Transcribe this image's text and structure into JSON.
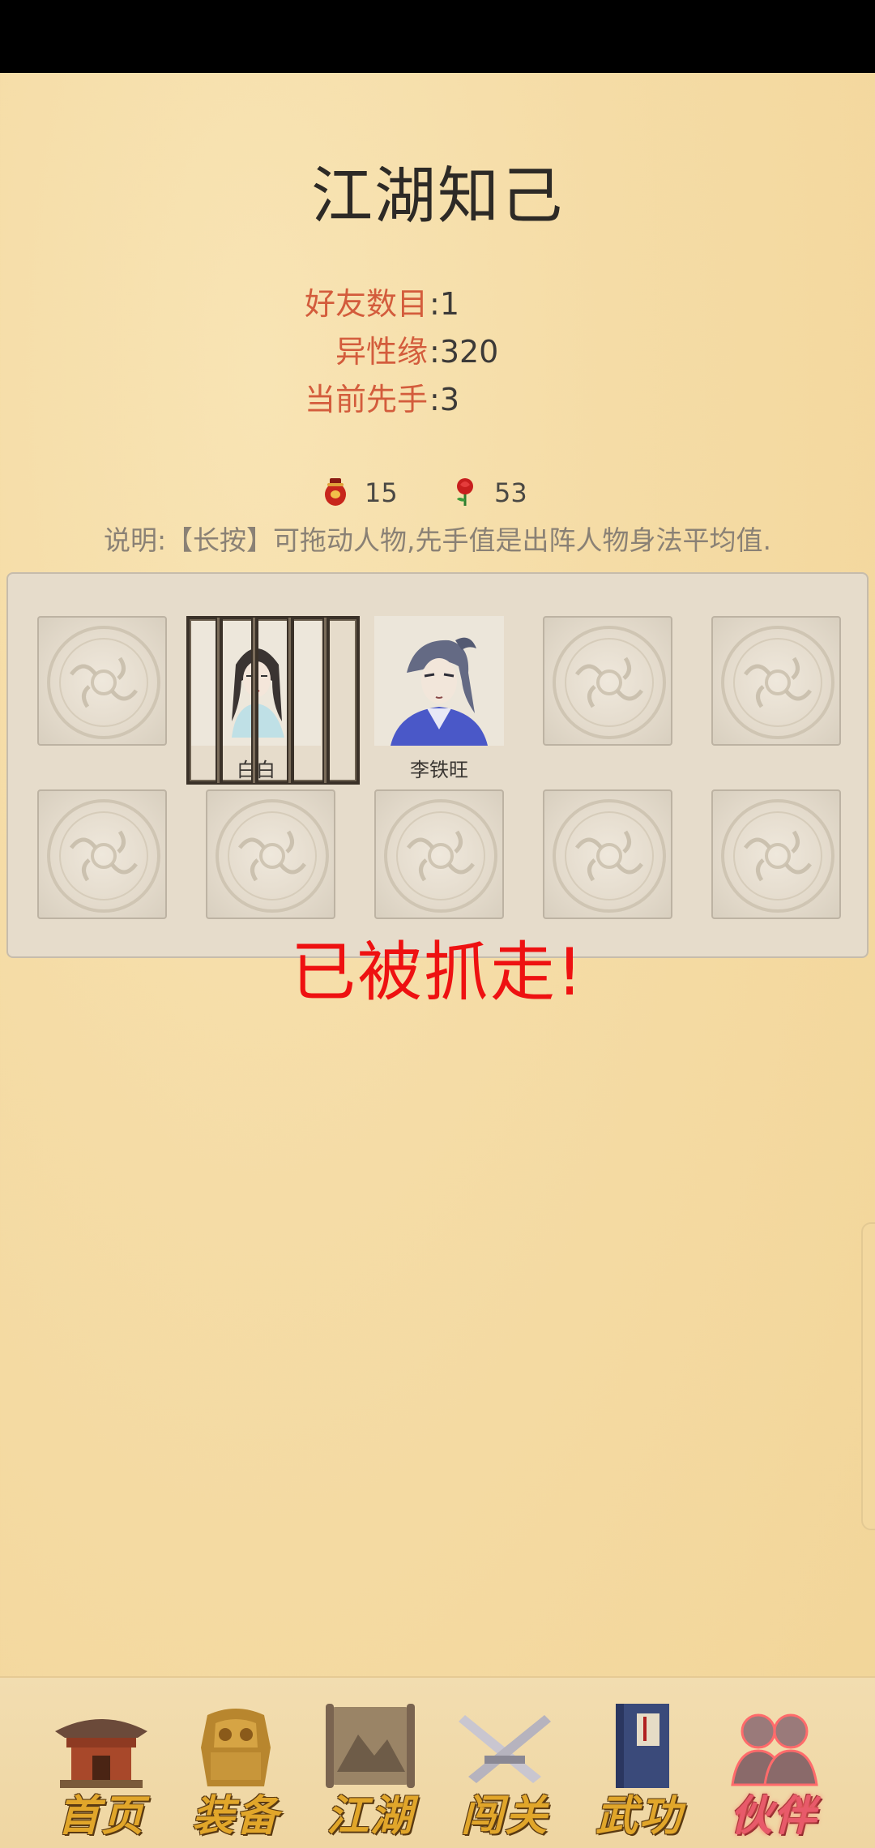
{
  "page": {
    "title": "江湖知己",
    "stats": [
      {
        "label": "好友数目",
        "value": "1"
      },
      {
        "label": "异性缘",
        "value": "320"
      },
      {
        "label": "当前先手",
        "value": "3"
      }
    ],
    "currency": [
      {
        "icon": "wine-jar-icon",
        "amount": "15"
      },
      {
        "icon": "rose-icon",
        "amount": "53"
      }
    ],
    "hint": "说明:【长按】可拖动人物,先手值是出阵人物身法平均值."
  },
  "characters": [
    {
      "name": "白白",
      "status": "caged"
    },
    {
      "name": "李铁旺",
      "status": "normal"
    }
  ],
  "captured_message": "已被抓走!",
  "nav": {
    "items": [
      {
        "label": "首页",
        "icon": "palace-icon",
        "active": false
      },
      {
        "label": "装备",
        "icon": "armor-icon",
        "active": false
      },
      {
        "label": "江湖",
        "icon": "scroll-map-icon",
        "active": false
      },
      {
        "label": "闯关",
        "icon": "crossed-swords-icon",
        "active": false
      },
      {
        "label": "武功",
        "icon": "martial-book-icon",
        "active": false
      },
      {
        "label": "伙伴",
        "icon": "companions-icon",
        "active": true
      }
    ]
  }
}
